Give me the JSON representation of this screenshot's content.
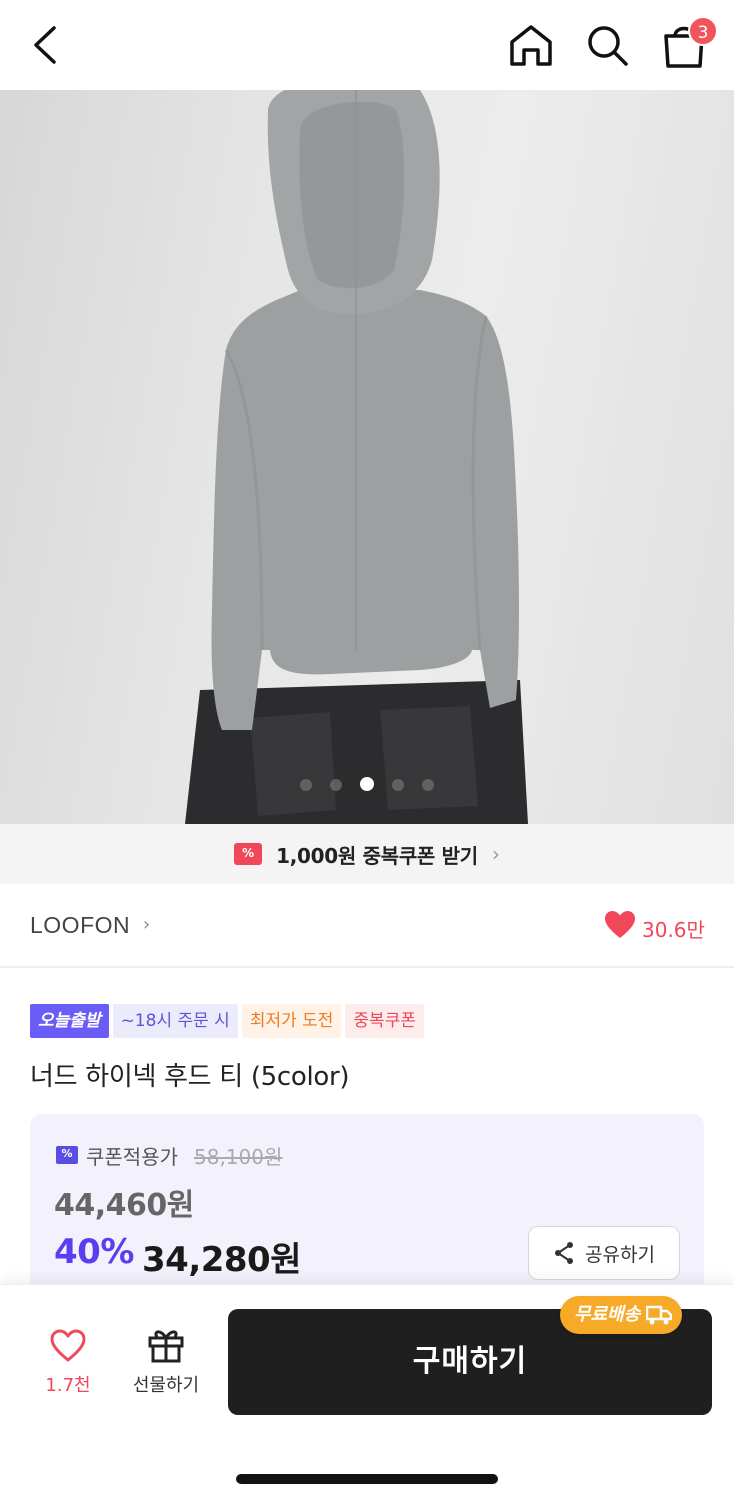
{
  "nav": {
    "back_icon": "chevron-left-icon",
    "home_icon": "home-icon",
    "search_icon": "search-icon",
    "cart_icon": "shopping-bag-icon",
    "cart_count": "3"
  },
  "gallery": {
    "slide_count": 5,
    "active_index": 2,
    "expand_icon": "fullscreen-icon"
  },
  "coupon_banner": {
    "icon_text": "%",
    "text": "1,000원 중복쿠폰 받기",
    "chevron": "›"
  },
  "brand": {
    "name": "LOOFON",
    "chevron": "›",
    "like_count": "30.6만"
  },
  "tags": [
    "오늘출발",
    "~18시 주문 시",
    "최저가 도전",
    "중복쿠폰"
  ],
  "product": {
    "title": "너드 하이넥 후드 티 (5color)"
  },
  "price": {
    "coupon_label": "쿠폰적용가",
    "coupon_icon_text": "%",
    "original": "58,100원",
    "mid": "44,460원",
    "discount": "40%",
    "final": "34,280원",
    "share_label": "공유하기"
  },
  "bottom": {
    "wish_count": "1.7천",
    "gift_label": "선물하기",
    "buy_label": "구매하기",
    "free_shipping": "무료배송"
  },
  "colors": {
    "accent_purple": "#5a3ff0",
    "like_red": "#f0475a",
    "free_ship_orange": "#f7a928",
    "buy_button": "#1f1f1f"
  }
}
